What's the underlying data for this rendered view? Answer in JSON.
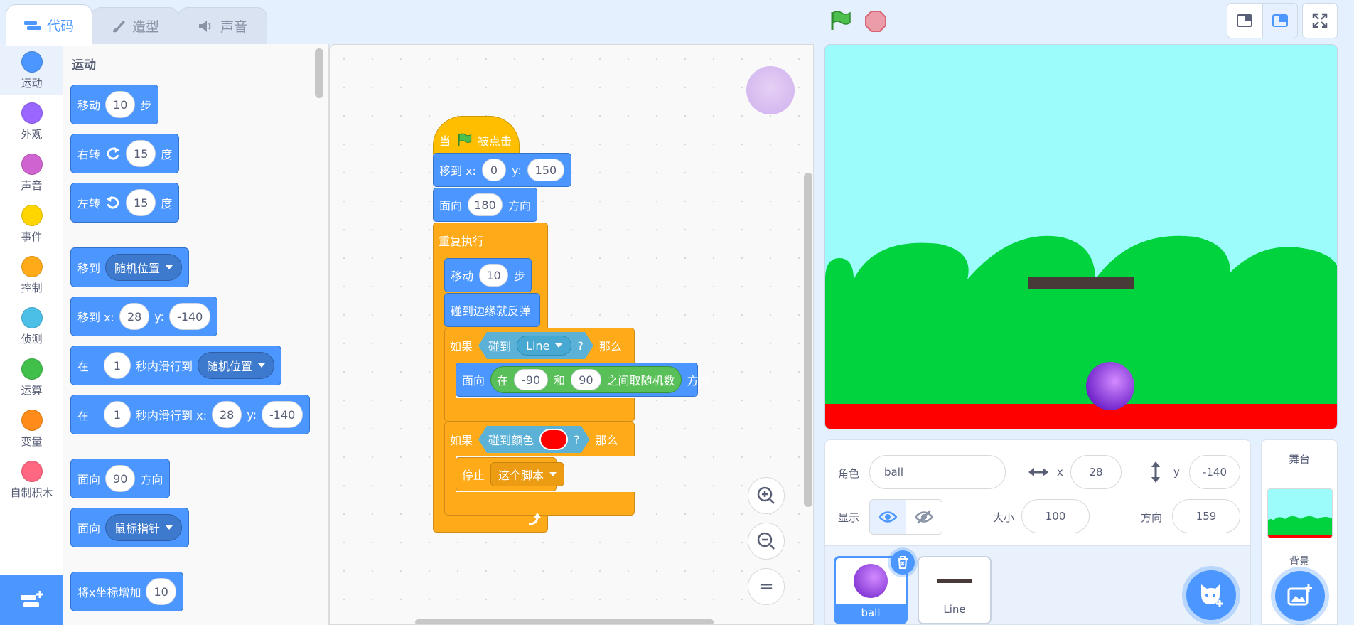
{
  "tabs": {
    "code": "代码",
    "costumes": "造型",
    "sounds": "声音"
  },
  "categories": [
    {
      "label": "运动",
      "color": "#4c97ff"
    },
    {
      "label": "外观",
      "color": "#9966ff"
    },
    {
      "label": "声音",
      "color": "#cf63cf"
    },
    {
      "label": "事件",
      "color": "#ffd500"
    },
    {
      "label": "控制",
      "color": "#ffab19"
    },
    {
      "label": "侦测",
      "color": "#4cbfe6"
    },
    {
      "label": "运算",
      "color": "#40bf4a"
    },
    {
      "label": "变量",
      "color": "#ff8c1a"
    },
    {
      "label": "自制积木",
      "color": "#ff6680"
    }
  ],
  "palette": {
    "title": "运动",
    "move": {
      "label": "移动",
      "value": "10",
      "unit": "步"
    },
    "turn_right": {
      "label": "右转",
      "value": "15",
      "unit": "度"
    },
    "turn_left": {
      "label": "左转",
      "value": "15",
      "unit": "度"
    },
    "goto": {
      "label": "移到",
      "option": "随机位置"
    },
    "goto_xy": {
      "label": "移到 x:",
      "x": "28",
      "ylabel": "y:",
      "y": "-140"
    },
    "glide": {
      "pre": "在",
      "secs": "1",
      "mid": "秒内滑行到",
      "option": "随机位置"
    },
    "glide_xy": {
      "pre": "在",
      "secs": "1",
      "mid": "秒内滑行到 x:",
      "x": "28",
      "ylabel": "y:",
      "y": "-140"
    },
    "point": {
      "label": "面向",
      "value": "90",
      "unit": "方向"
    },
    "point_towards": {
      "label": "面向",
      "option": "鼠标指针"
    },
    "change_x": {
      "label": "将x坐标增加",
      "value": "10"
    }
  },
  "script": {
    "hat": {
      "pre": "当",
      "post": "被点击"
    },
    "goto": {
      "label": "移到 x:",
      "x": "0",
      "ylabel": "y:",
      "y": "150"
    },
    "point": {
      "label": "面向",
      "value": "180",
      "unit": "方向"
    },
    "forever": "重复执行",
    "move": {
      "label": "移动",
      "value": "10",
      "unit": "步"
    },
    "bounce": "碰到边缘就反弹",
    "if1": {
      "label": "如果",
      "cond": "碰到",
      "target": "Line",
      "q": "?",
      "then": "那么"
    },
    "point_random": {
      "label": "面向",
      "pre": "在",
      "a": "-90",
      "and": "和",
      "b": "90",
      "post": "之间取随机数",
      "unit": "方向"
    },
    "if2": {
      "label": "如果",
      "cond": "碰到颜色",
      "color": "#ff0000",
      "q": "?",
      "then": "那么"
    },
    "stop": {
      "label": "停止",
      "option": "这个脚本"
    },
    "zoom_reset": "="
  },
  "sprite_info": {
    "sprite_label": "角色",
    "sprite_name": "ball",
    "x_label": "x",
    "x": "28",
    "y_label": "y",
    "y": "-140",
    "show_label": "显示",
    "size_label": "大小",
    "size": "100",
    "direction_label": "方向",
    "direction": "159"
  },
  "sprites": [
    {
      "name": "ball"
    },
    {
      "name": "Line"
    }
  ],
  "stage_pane": {
    "title": "舞台",
    "backdrop_label": "背景"
  }
}
